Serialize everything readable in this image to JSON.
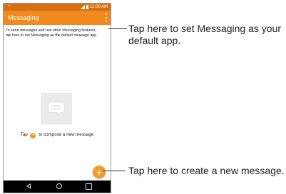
{
  "status_bar": {
    "time": "12:00 AM"
  },
  "app_bar": {
    "title": "Messaging"
  },
  "banner": {
    "line1": "To send messages and use other Messaging features,",
    "line2": "tap here to set Messaging as the default message app."
  },
  "empty_state": {
    "text_before": "Tap",
    "text_after": "to compose a new message"
  },
  "fab": {
    "symbol": "+"
  },
  "callouts": {
    "default_app_line1": "Tap here to set Messaging as your",
    "default_app_line2": "default app.",
    "new_message": "Tap here to create a new message."
  },
  "colors": {
    "status_bar": "#d66f13",
    "app_bar": "#f08a1c",
    "accent": "#f39a2a"
  },
  "icons": {
    "overflow": "more-vertical-icon",
    "empty": "message-bubble-icon",
    "nav": [
      "back-icon",
      "home-icon",
      "recent-apps-icon"
    ]
  }
}
